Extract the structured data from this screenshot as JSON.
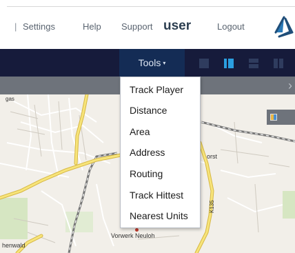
{
  "header": {
    "separator": "|",
    "links": {
      "settings": "Settings",
      "help": "Help",
      "support": "Support",
      "user": "user",
      "logout": "Logout"
    },
    "logo_icon": "brand-logo-icon"
  },
  "navbar": {
    "tools_label": "Tools",
    "tools_caret": "▾",
    "layout_buttons": [
      "layout-single-icon",
      "layout-split-vertical-icon",
      "layout-split-horizontal-icon",
      "layout-quad-icon"
    ],
    "active_layout_color": "#2b9fe0",
    "background_color": "#161b3b"
  },
  "subbar": {
    "chevron": "›"
  },
  "tools_menu": {
    "items": [
      "Track Player",
      "Distance",
      "Area",
      "Address",
      "Routing",
      "Track Hittest",
      "Nearest Units"
    ]
  },
  "map": {
    "labels": {
      "horst": "orst",
      "vorwerk": "Vorwerk Neuloh",
      "hen": "henwald",
      "k135": "K135",
      "gas": "gas"
    },
    "road_color": "#f7e47a"
  }
}
